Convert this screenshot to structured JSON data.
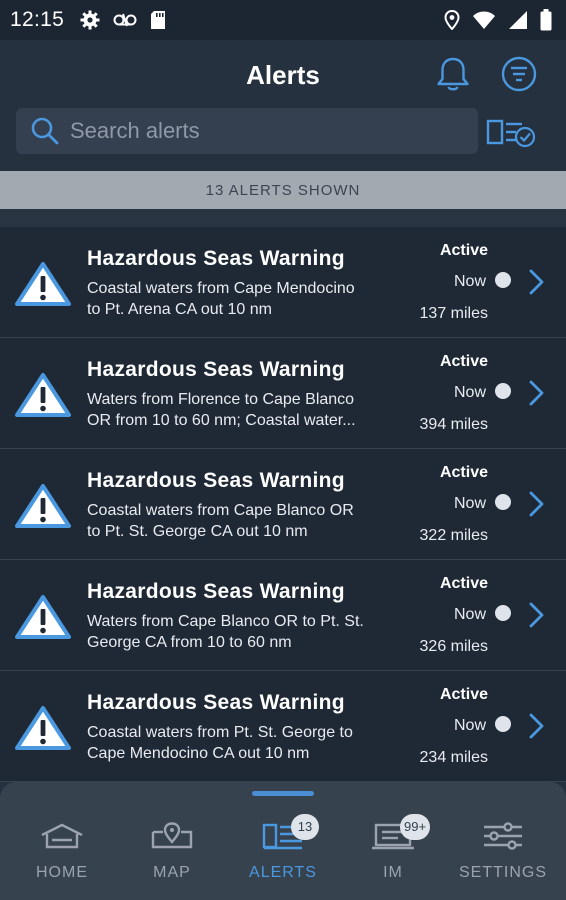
{
  "status_bar": {
    "time": "12:15",
    "left_icons": [
      "settings-gear-icon",
      "voicemail-icon",
      "sd-card-icon"
    ],
    "right_icons": [
      "location-icon",
      "wifi-icon",
      "signal-icon",
      "battery-icon"
    ]
  },
  "header": {
    "title": "Alerts",
    "bell_icon": "bell-icon",
    "filter_icon": "filter-icon"
  },
  "search": {
    "placeholder": "Search alerts",
    "icon": "search-icon",
    "select_icon": "select-items-icon"
  },
  "banner": {
    "text": "13 ALERTS SHOWN"
  },
  "alerts": [
    {
      "title": "Hazardous Seas Warning",
      "desc_line1": "Coastal waters from Cape Mendocino",
      "desc_line2": "to Pt. Arena CA out 10 nm",
      "status": "Active",
      "time": "Now",
      "distance": "137 miles"
    },
    {
      "title": "Hazardous Seas Warning",
      "desc_line1": "Waters from Florence to Cape Blanco",
      "desc_line2": "OR from 10 to 60 nm; Coastal water...",
      "status": "Active",
      "time": "Now",
      "distance": "394 miles"
    },
    {
      "title": "Hazardous Seas Warning",
      "desc_line1": "Coastal waters from Cape Blanco OR",
      "desc_line2": "to Pt. St. George CA out 10 nm",
      "status": "Active",
      "time": "Now",
      "distance": "322 miles"
    },
    {
      "title": "Hazardous Seas Warning",
      "desc_line1": "Waters from Cape Blanco OR to Pt. St.",
      "desc_line2": "George CA from 10 to 60 nm",
      "status": "Active",
      "time": "Now",
      "distance": "326 miles"
    },
    {
      "title": "Hazardous Seas Warning",
      "desc_line1": "Coastal waters from Pt. St. George to",
      "desc_line2": "Cape Mendocino CA out 10 nm",
      "status": "Active",
      "time": "Now",
      "distance": "234 miles"
    }
  ],
  "nav": {
    "tabs": [
      {
        "label": "HOME",
        "icon": "home-icon"
      },
      {
        "label": "MAP",
        "icon": "map-icon"
      },
      {
        "label": "ALERTS",
        "icon": "alerts-list-icon",
        "badge": "13",
        "active": true
      },
      {
        "label": "IM",
        "icon": "im-icon",
        "badge": "99+"
      },
      {
        "label": "SETTINGS",
        "icon": "settings-sliders-icon"
      }
    ]
  },
  "colors": {
    "background": "#26313f",
    "list_background": "#1f2835",
    "accent": "#4a98e0",
    "banner": "#a3a9b1",
    "nav_background": "#37424f"
  }
}
